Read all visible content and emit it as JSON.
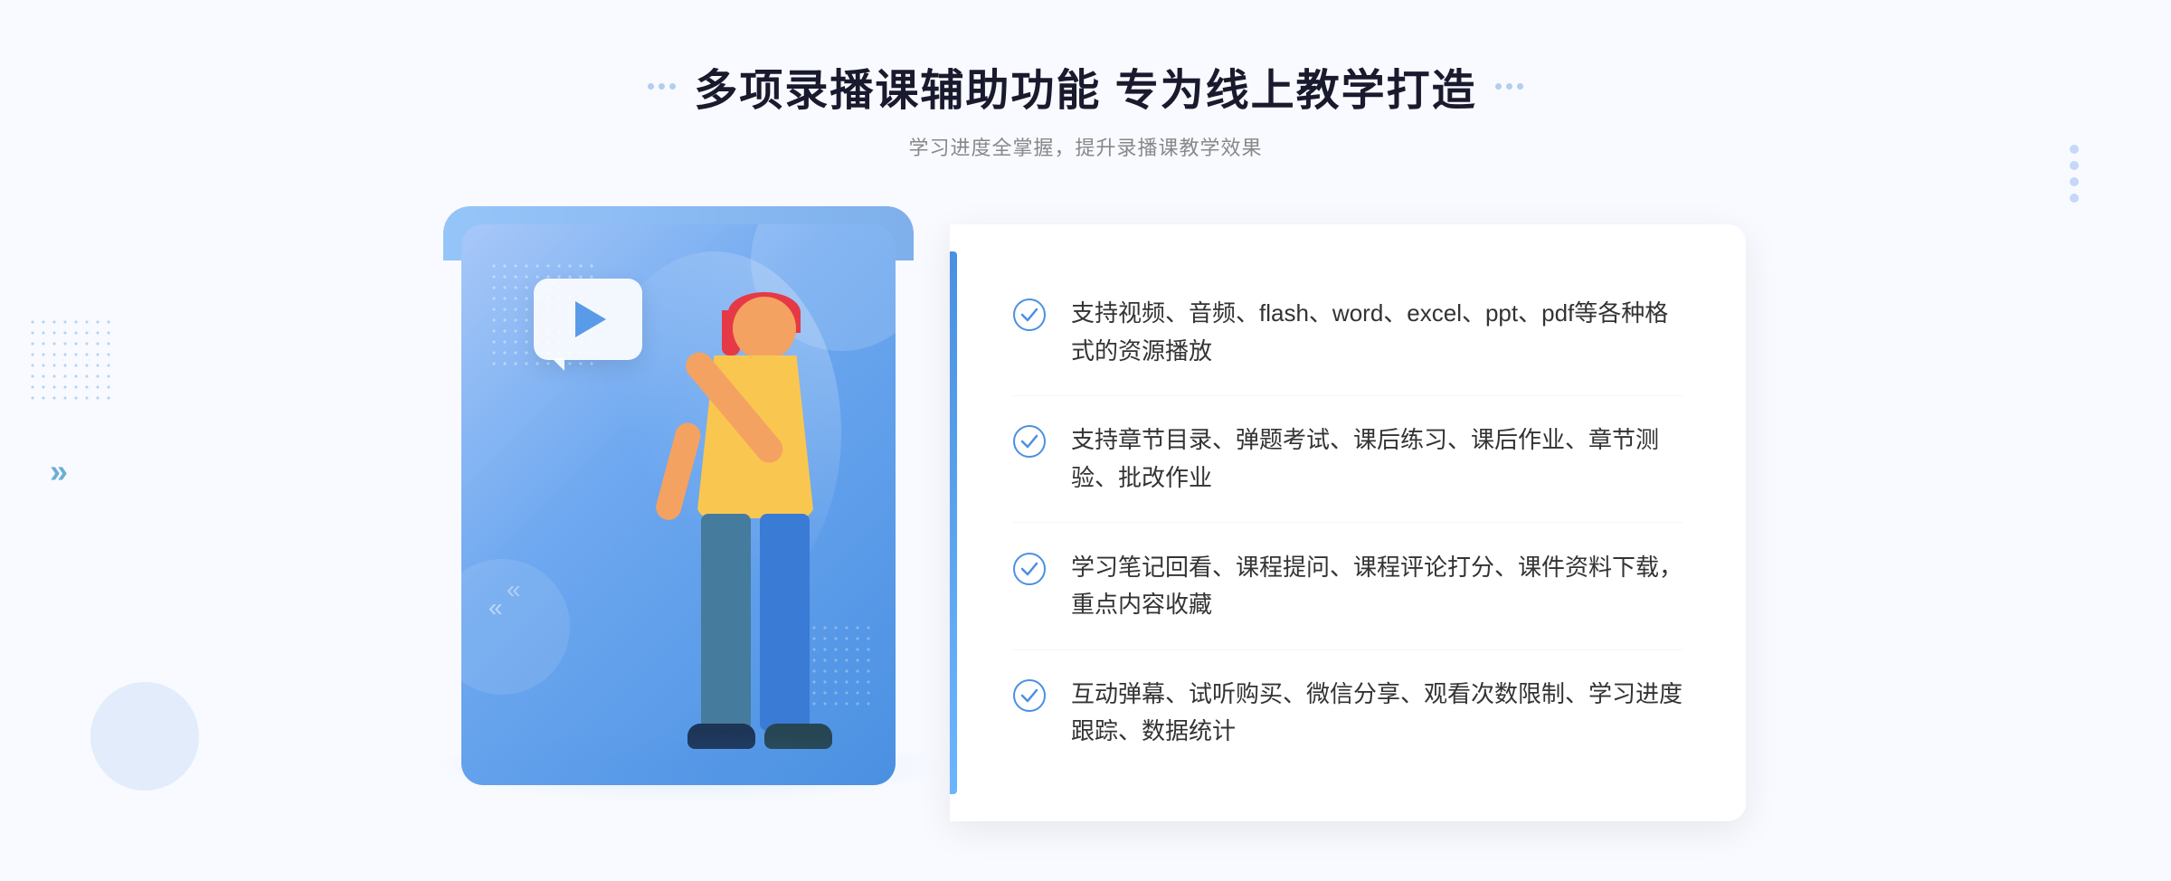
{
  "header": {
    "title": "多项录播课辅助功能 专为线上教学打造",
    "subtitle": "学习进度全掌握，提升录播课教学效果",
    "title_dots_left": [
      "dot",
      "dot"
    ],
    "title_dots_right": [
      "dot",
      "dot"
    ]
  },
  "features": [
    {
      "id": 1,
      "text": "支持视频、音频、flash、word、excel、ppt、pdf等各种格式的资源播放"
    },
    {
      "id": 2,
      "text": "支持章节目录、弹题考试、课后练习、课后作业、章节测验、批改作业"
    },
    {
      "id": 3,
      "text": "学习笔记回看、课程提问、课程评论打分、课件资料下载，重点内容收藏"
    },
    {
      "id": 4,
      "text": "互动弹幕、试听购买、微信分享、观看次数限制、学习进度跟踪、数据统计"
    }
  ],
  "colors": {
    "accent_blue": "#4a90e2",
    "light_blue": "#6baef6",
    "text_dark": "#1a1a2e",
    "text_gray": "#888888",
    "check_color": "#4a90e2"
  },
  "decoration": {
    "arrows_left": "»"
  }
}
